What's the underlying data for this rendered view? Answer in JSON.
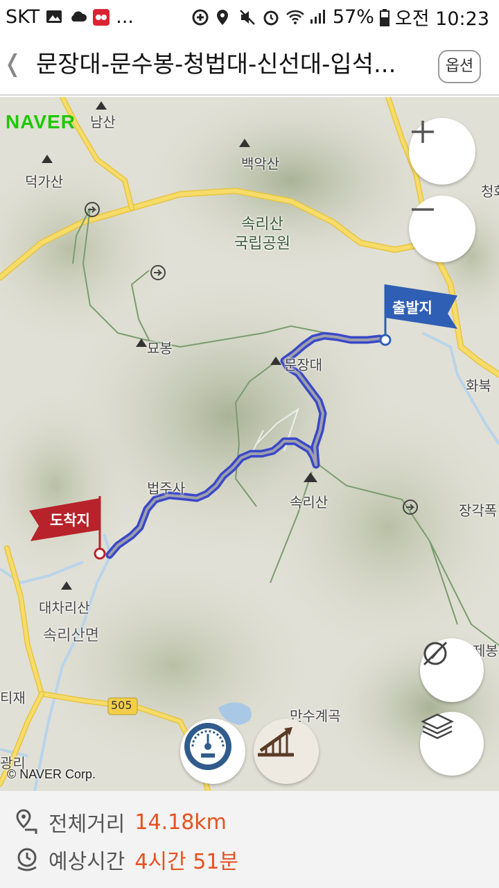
{
  "status_bar": {
    "carrier": "SKT",
    "more": "...",
    "battery": "57%",
    "time": "오전 10:23"
  },
  "header": {
    "back_icon": "chevron-left-icon",
    "title": "문장대-문수봉-청법대-신선대-입석...",
    "option_label": "옵션"
  },
  "map": {
    "logo": "NAVER",
    "copyright": "© NAVER Corp.",
    "labels": {
      "namsan": "남산",
      "baegaksan": "백악산",
      "deokgasan": "덕가산",
      "cheong": "청화",
      "park": "속리산\n국립공원",
      "myobong": "묘봉",
      "munjangdae": "문장대",
      "hwabuk": "화북",
      "beopjusa": "법주사",
      "songnisan": "속리산",
      "janggak": "장각폭",
      "daecharisan": "대차리산",
      "songnisan_myeon": "속리산면",
      "tijae": "티재",
      "jebong": "제봉",
      "mansugyegok": "만수계곡",
      "gwangri": "광리",
      "road_number": "505"
    },
    "start_flag": "출발지",
    "end_flag": "도착지",
    "accent": {
      "route": "#3a48c8",
      "start_flag": "#2f5fb4",
      "end_flag": "#b8222a",
      "road_yellow": "#f3cf48"
    }
  },
  "controls": {
    "zoom_in_icon": "plus-icon",
    "zoom_out_icon": "minus-icon",
    "compass_icon": "compass-off-icon",
    "layers_icon": "layers-icon",
    "gauge_icon": "speedometer-icon",
    "elevation_icon": "elevation-chart-icon"
  },
  "summary": {
    "distance_label": "전체거리",
    "distance_value": "14.18km",
    "time_label": "예상시간",
    "time_value": "4시간 51분"
  }
}
